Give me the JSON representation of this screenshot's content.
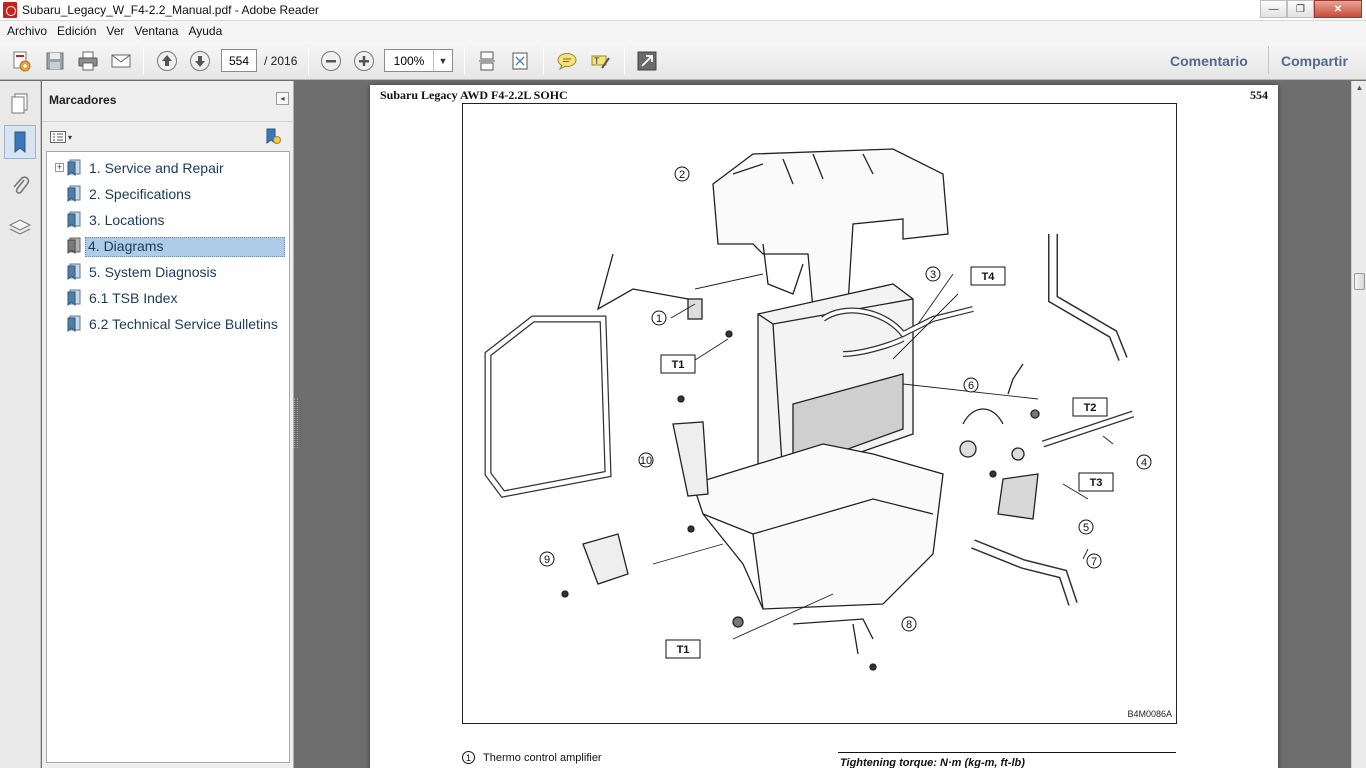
{
  "window": {
    "title": "Subaru_Legacy_W_F4-2.2_Manual.pdf - Adobe Reader",
    "minimize": "—",
    "maximize": "❐",
    "close": "✕"
  },
  "menu": [
    "Archivo",
    "Edición",
    "Ver",
    "Ventana",
    "Ayuda"
  ],
  "toolbar": {
    "current_page": "554",
    "total_pages": "/  2016",
    "zoom": "100%",
    "comment_label": "Comentario",
    "share_label": "Compartir",
    "icons": [
      "create-pdf-icon",
      "save-icon",
      "print-icon",
      "email-icon",
      "previous-page-icon",
      "next-page-icon",
      "zoom-out-icon",
      "zoom-in-icon",
      "scrolling-mode-icon",
      "fit-page-icon",
      "sticky-note-icon",
      "highlight-icon",
      "expand-icon"
    ]
  },
  "nav": {
    "icons": [
      "pages-icon",
      "bookmarks-icon",
      "attachments-icon",
      "layers-icon"
    ],
    "active": "bookmarks-icon"
  },
  "bookmarks": {
    "title": "Marcadores",
    "collapse_glyph": "◂",
    "options_glyph": "▾",
    "items": [
      {
        "label": "1. Service and Repair",
        "expandable": true,
        "selected": false
      },
      {
        "label": "2. Specifications",
        "expandable": false,
        "selected": false
      },
      {
        "label": "3. Locations",
        "expandable": false,
        "selected": false
      },
      {
        "label": "4. Diagrams",
        "expandable": false,
        "selected": true
      },
      {
        "label": "5. System Diagnosis",
        "expandable": false,
        "selected": false
      },
      {
        "label": "6.1 TSB Index",
        "expandable": false,
        "selected": false
      },
      {
        "label": "6.2 Technical Service Bulletins",
        "expandable": false,
        "selected": false
      }
    ]
  },
  "document": {
    "header": "Subaru Legacy AWD F4-2.2L SOHC",
    "page_number": "554",
    "figure_code": "B4M0086A",
    "callouts": [
      "1",
      "2",
      "3",
      "4",
      "5",
      "6",
      "7",
      "8",
      "9",
      "10"
    ],
    "torque_labels": [
      "T1",
      "T2",
      "T3",
      "T4",
      "T1"
    ],
    "legend_number": "1",
    "legend_text": "Thermo control amplifier",
    "torque_heading": "Tightening torque: N·m (kg-m, ft-lb)"
  },
  "scrollbar": {
    "up_glyph": "▲"
  }
}
